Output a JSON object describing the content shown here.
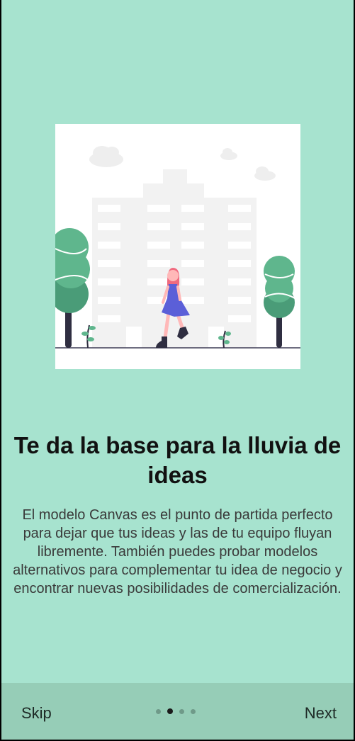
{
  "onboarding": {
    "title": "Te da la base para la lluvia de ideas",
    "description": "El modelo Canvas es el punto de partida perfecto para dejar que tus ideas y las de tu equipo fluyan libremente. También puedes probar modelos alternativos para complementar tu idea de negocio y encontrar nuevas posibilidades de comercialización.",
    "illustration_icon": "woman-walking-city-illustration"
  },
  "navigation": {
    "skip_label": "Skip",
    "next_label": "Next",
    "pages_total": 4,
    "current_page": 2
  },
  "colors": {
    "background": "#a7e3cf",
    "bottom_bar": "#96cdb7",
    "tree_green": "#5fb68d",
    "dress": "#5b5fd8",
    "hair": "#f06a7f"
  }
}
